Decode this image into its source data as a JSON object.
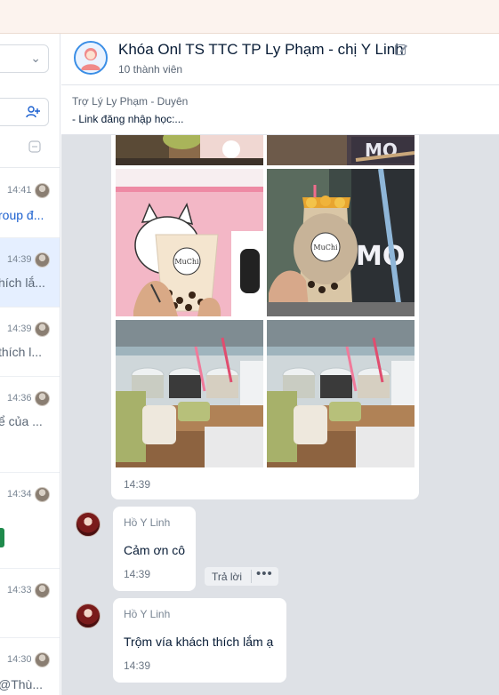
{
  "sidebar": {
    "conversations": [
      {
        "time": "14:41",
        "snippet": "roup đ..."
      },
      {
        "time": "14:39",
        "snippet": "hích lắ..."
      },
      {
        "time": "14:39",
        "snippet": "thích l..."
      },
      {
        "time": "14:36",
        "snippet": "ể của ..."
      },
      {
        "time": "14:34",
        "snippet": ""
      },
      {
        "time": "14:33",
        "snippet": ""
      },
      {
        "time": "14:30",
        "snippet": "@Thù..."
      }
    ]
  },
  "header": {
    "title": "Khóa Onl TS TTC TP Ly Phạm - chị Y Linh",
    "members": "10 thành viên"
  },
  "pinned": {
    "title": "Trợ Lý Ly Phạm - Duyên",
    "text": "- Link đăng nhập học:..."
  },
  "image_message": {
    "time": "14:39",
    "cup_brand": "MuChi"
  },
  "messages": [
    {
      "sender": "Hồ Y Linh",
      "text": "Cảm ơn cô",
      "time": "14:39"
    },
    {
      "sender": "Hồ Y Linh",
      "text": "Trộm vía khách thích lắm ạ",
      "time": "14:39"
    }
  ],
  "actions": {
    "reply": "Trả lời",
    "more": "•••"
  },
  "colors": {
    "accent": "#1a5fcf",
    "chat_bg": "#dee1e6",
    "active_row": "#e5efff"
  }
}
